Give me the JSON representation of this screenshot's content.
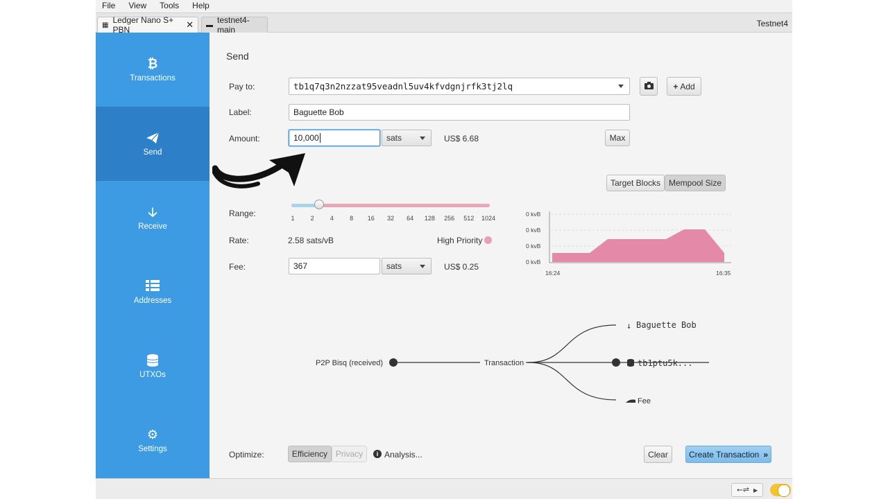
{
  "menu": [
    "File",
    "View",
    "Tools",
    "Help"
  ],
  "tabs": {
    "wallet": "Ledger Nano S+ PBN",
    "other": "testnet4-main",
    "network": "Testnet4"
  },
  "sidebar": {
    "items": [
      {
        "label": "Transactions",
        "icon": "bitcoin-icon"
      },
      {
        "label": "Send",
        "icon": "paper-plane-icon"
      },
      {
        "label": "Receive",
        "icon": "arrow-down-icon"
      },
      {
        "label": "Addresses",
        "icon": "list-icon"
      },
      {
        "label": "UTXOs",
        "icon": "coins-icon"
      },
      {
        "label": "Settings",
        "icon": "gear-icon"
      }
    ]
  },
  "send": {
    "title": "Send",
    "pay_to_label": "Pay to:",
    "pay_to_value": "tb1q7q3n2nzzat95veadnl5uv4kfvdgnjrfk3tj2lq",
    "add_label": "Add",
    "label_label": "Label:",
    "label_value": "Baguette Bob",
    "amount_label": "Amount:",
    "amount_value": "10,000",
    "amount_unit": "sats",
    "amount_fiat": "US$ 6.68",
    "max_label": "Max",
    "fee_mode": {
      "target_blocks": "Target Blocks",
      "mempool_size": "Mempool Size"
    },
    "range_label": "Range:",
    "range_ticks": [
      "1",
      "2",
      "4",
      "8",
      "16",
      "32",
      "64",
      "128",
      "256",
      "512",
      "1024"
    ],
    "range_fraction": 0.141,
    "rate_label": "Rate:",
    "rate_value": "2.58 sats/vB",
    "priority_label": "High Priority",
    "fee_label": "Fee:",
    "fee_value": "367",
    "fee_unit": "sats",
    "fee_fiat": "US$ 0.25",
    "optimize_label": "Optimize:",
    "efficiency_label": "Efficiency",
    "privacy_label": "Privacy",
    "analysis_label": "Analysis...",
    "clear_label": "Clear",
    "create_label": "Create Transaction"
  },
  "mempool_chart": {
    "y_labels": [
      "0 kvB",
      "0 kvB",
      "0 kvB",
      "0 kvB"
    ],
    "x_labels": [
      "16:24",
      "16:35"
    ],
    "color": "#e48aa8"
  },
  "diagram": {
    "input": "P2P Bisq (received)",
    "center": "Transaction",
    "outputs": [
      "Baguette Bob",
      "tb1ptu5k...",
      "Fee"
    ]
  },
  "colors": {
    "sidebar": "#3d9be3",
    "sidebar_active": "#2d7fc8",
    "accent_pink": "#e8a0b5"
  }
}
